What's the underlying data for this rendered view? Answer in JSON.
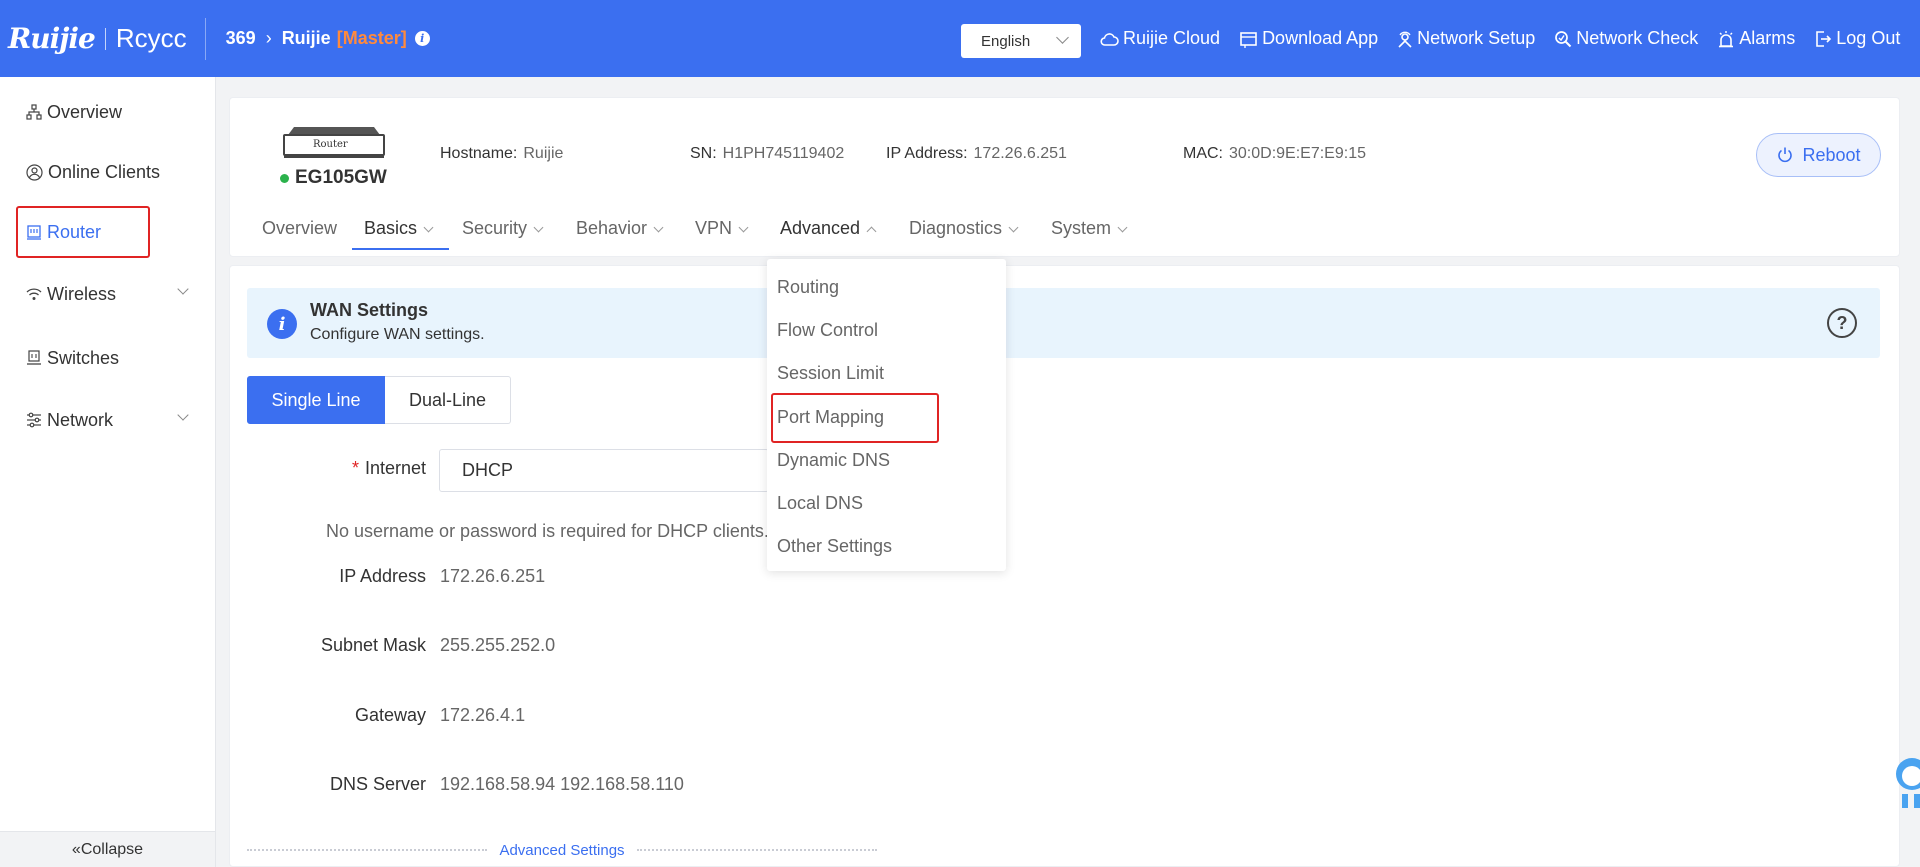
{
  "brand": {
    "ruijie": "Ruijie",
    "reyee": "Rcycc"
  },
  "breadcrumb": {
    "network_id": "369",
    "device": "Ruijie",
    "role": "[Master]"
  },
  "language": {
    "selected": "English"
  },
  "top_actions": [
    {
      "label": "Ruijie Cloud",
      "icon": "cloud-icon"
    },
    {
      "label": "Download App",
      "icon": "download-app-icon"
    },
    {
      "label": "Network Setup",
      "icon": "network-setup-icon"
    },
    {
      "label": "Network Check",
      "icon": "network-check-icon"
    },
    {
      "label": "Alarms",
      "icon": "alarm-icon"
    },
    {
      "label": "Log Out",
      "icon": "logout-icon"
    }
  ],
  "sidebar": {
    "items": [
      {
        "label": "Overview",
        "icon": "topology-icon"
      },
      {
        "label": "Online Clients",
        "icon": "user-icon"
      },
      {
        "label": "Router",
        "icon": "router-icon",
        "active": true
      },
      {
        "label": "Wireless",
        "icon": "wifi-icon",
        "expandable": true
      },
      {
        "label": "Switches",
        "icon": "switch-icon"
      },
      {
        "label": "Network",
        "icon": "network-settings-icon",
        "expandable": true
      }
    ],
    "collapse_label": "Collapse",
    "active_color": "#3b6ff0"
  },
  "device": {
    "image_label": "Router",
    "model": "EG105GW",
    "status_color": "#2bb24c",
    "hostname_label": "Hostname:",
    "hostname": "Ruijie",
    "sn_label": "SN:",
    "sn": "H1PH745119402",
    "ip_label": "IP Address:",
    "ip": "172.26.6.251",
    "mac_label": "MAC:",
    "mac": "30:0D:9E:E7:E9:15",
    "reboot_label": "Reboot"
  },
  "tabs": [
    {
      "label": "Overview"
    },
    {
      "label": "Basics",
      "active": true
    },
    {
      "label": "Security"
    },
    {
      "label": "Behavior"
    },
    {
      "label": "VPN"
    },
    {
      "label": "Advanced",
      "open": true
    },
    {
      "label": "Diagnostics"
    },
    {
      "label": "System"
    }
  ],
  "advanced_menu": [
    "Routing",
    "Flow Control",
    "Session Limit",
    "Port Mapping",
    "Dynamic DNS",
    "Local DNS",
    "Other Settings"
  ],
  "banner": {
    "title": "WAN Settings",
    "description": "Configure WAN settings."
  },
  "line_mode": {
    "single": "Single Line",
    "dual": "Dual-Line",
    "selected": "Single Line"
  },
  "form": {
    "internet_label": "Internet",
    "internet_value": "DHCP",
    "dhcp_hint": "No username or password is required for DHCP clients.",
    "ip_label": "IP Address",
    "ip_value": "172.26.6.251",
    "mask_label": "Subnet Mask",
    "mask_value": "255.255.252.0",
    "gateway_label": "Gateway",
    "gateway_value": "172.26.4.1",
    "dns_label": "DNS Server",
    "dns_value": "192.168.58.94 192.168.58.110"
  },
  "advanced_settings_label": "Advanced Settings",
  "colors": {
    "primary": "#3b6ff0",
    "master": "#ff8a3d",
    "highlight": "#e02424"
  }
}
